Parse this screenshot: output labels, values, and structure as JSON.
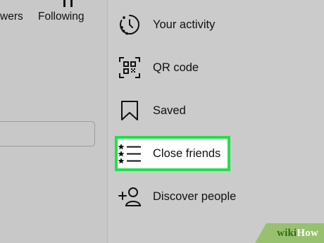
{
  "profile": {
    "followers_label": "wers",
    "following_label": "Following"
  },
  "menu": {
    "items": [
      {
        "label": "Your activity",
        "icon": "activity-clock-icon"
      },
      {
        "label": "QR code",
        "icon": "qr-code-icon"
      },
      {
        "label": "Saved",
        "icon": "bookmark-icon"
      },
      {
        "label": "Close friends",
        "icon": "close-friends-list-icon"
      },
      {
        "label": "Discover people",
        "icon": "add-person-icon"
      }
    ]
  },
  "watermark": {
    "prefix": "wiki",
    "suffix": "How"
  },
  "colors": {
    "highlight": "#22e04a",
    "background": "#c9c9c9"
  }
}
